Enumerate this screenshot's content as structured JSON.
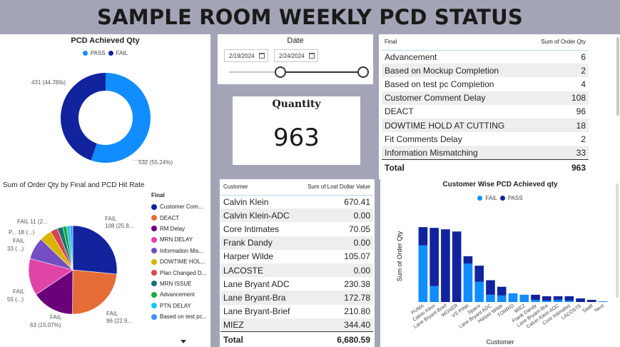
{
  "header": {
    "title": "SAMPLE ROOM WEEKLY PCD STATUS"
  },
  "donut": {
    "title": "PCD Achieved Qty",
    "legend": [
      {
        "label": "PASS",
        "color": "#118dff"
      },
      {
        "label": "FAIL",
        "color": "#12239e"
      }
    ],
    "fail_label": "431 (44.76%)",
    "pass_label": "532 (55.24%)",
    "chart_data": {
      "type": "pie",
      "categories": [
        "PASS",
        "FAIL"
      ],
      "values": [
        532,
        431
      ],
      "percentages": [
        55.24,
        44.76
      ]
    }
  },
  "date_slicer": {
    "title": "Date",
    "start": "2/19/2024",
    "end": "2/24/2024",
    "range_fraction_start": 0.0,
    "range_fraction_end": 1.0
  },
  "card": {
    "label": "Quantity",
    "value": "963"
  },
  "final_table": {
    "col1": "Final",
    "col2": "Sum of Order Qty",
    "rows": [
      {
        "name": "Advancement",
        "value": "6"
      },
      {
        "name": "Based on Mockup Completion",
        "value": "2"
      },
      {
        "name": "Based on test pc Completion",
        "value": "4"
      },
      {
        "name": "Customer Comment Delay",
        "value": "108"
      },
      {
        "name": "DEACT",
        "value": "96"
      },
      {
        "name": "DOWTIME HOLD AT CUTTING",
        "value": "18"
      },
      {
        "name": "Fit Comments Delay",
        "value": "2"
      },
      {
        "name": "Information Mismatching",
        "value": "33"
      }
    ],
    "total_label": "Total",
    "total_value": "963"
  },
  "pie": {
    "title": "Sum of Order Qty by Final and PCD Hit Rate",
    "legend_title": "Final",
    "legend": [
      {
        "label": "Customer Com...",
        "color": "#12239e"
      },
      {
        "label": "DEACT",
        "color": "#e66c37"
      },
      {
        "label": "RM Delay",
        "color": "#6b007b"
      },
      {
        "label": "MRN DELAY",
        "color": "#e044a7"
      },
      {
        "label": "Information Mis...",
        "color": "#744ec2"
      },
      {
        "label": "DOWTIME HOL...",
        "color": "#d9b300"
      },
      {
        "label": "Plan Changed D...",
        "color": "#d64550"
      },
      {
        "label": "MRN ISSUE",
        "color": "#197278"
      },
      {
        "label": "Advancement",
        "color": "#1aab40"
      },
      {
        "label": "PTN DELAY",
        "color": "#15c6f4"
      },
      {
        "label": "Based on test pc...",
        "color": "#4092ff"
      }
    ],
    "labels": {
      "l1": "FAIL",
      "l1b": "108 (25.8...",
      "l2": "FAIL",
      "l2b": "96 (22.9...",
      "l3": "FAIL",
      "l3b": "63 (15.07%)",
      "l4": "FAIL",
      "l4b": "55 (...)",
      "l5": "FAIL",
      "l5b": "33 (...)",
      "l6": "P... 18 (...)",
      "l7": "FAIL 11 (2..."
    },
    "chart_data": {
      "type": "pie",
      "categories": [
        "Customer Comment Delay",
        "DEACT",
        "RM Delay",
        "MRN DELAY",
        "Information Mismatching",
        "DOWTIME HOLD AT CUTTING",
        "Plan Changed D...",
        "MRN ISSUE",
        "Advancement",
        "PTN DELAY",
        "Based on test pc..."
      ],
      "values": [
        108,
        96,
        63,
        55,
        33,
        18,
        11,
        8,
        6,
        5,
        4
      ]
    }
  },
  "lost_table": {
    "col1": "Customer",
    "col2": "Sum of Lost Dollar Value",
    "rows": [
      {
        "name": "Calvin Klein",
        "value": "670.41"
      },
      {
        "name": "Calvin Klein-ADC",
        "value": "0.00"
      },
      {
        "name": "Core Intimates",
        "value": "70.05"
      },
      {
        "name": "Frank Dandy",
        "value": "0.00"
      },
      {
        "name": "Harper Wilde",
        "value": "105.07"
      },
      {
        "name": "LACOSTE",
        "value": "0.00"
      },
      {
        "name": "Lane Bryant ADC",
        "value": "230.38"
      },
      {
        "name": "Lane Bryant-Bra",
        "value": "172.78"
      },
      {
        "name": "Lane Bryant-Brief",
        "value": "210.80"
      },
      {
        "name": "MIEZ",
        "value": "344.40"
      }
    ],
    "total_label": "Total",
    "total_value": "6,680.59"
  },
  "bar": {
    "title": "Customer Wise PCD Achieved qty",
    "legend": [
      {
        "label": "FAIL",
        "color": "#118dff"
      },
      {
        "label": "PASS",
        "color": "#12239e"
      }
    ],
    "ylabel": "Sum of Order Qty",
    "xlabel": "Customer",
    "chart_data": {
      "type": "bar",
      "stacked": true,
      "categories": [
        "PUMA",
        "Calvin Klein",
        "Lane Bryant-Brief",
        "WOXER",
        "VS PINK",
        "Spanx",
        "Lane Bryant ADC",
        "Harper Wilde",
        "TORRID",
        "MIEZ",
        "Frank Dandy",
        "Lane Bryant-Bra",
        "Calvin Klein-ADC",
        "Core Intimates",
        "LACOSTE",
        "Saalt",
        "Next"
      ],
      "series": [
        {
          "name": "FAIL",
          "values": [
            78,
            22,
            0,
            0,
            53,
            28,
            10,
            9,
            12,
            10,
            3,
            2,
            3,
            2,
            0,
            0,
            1
          ]
        },
        {
          "name": "PASS",
          "values": [
            25,
            80,
            100,
            97,
            10,
            22,
            20,
            12,
            0,
            0,
            7,
            6,
            5,
            6,
            5,
            3,
            0
          ]
        }
      ],
      "ylim": [
        0,
        110
      ]
    }
  }
}
